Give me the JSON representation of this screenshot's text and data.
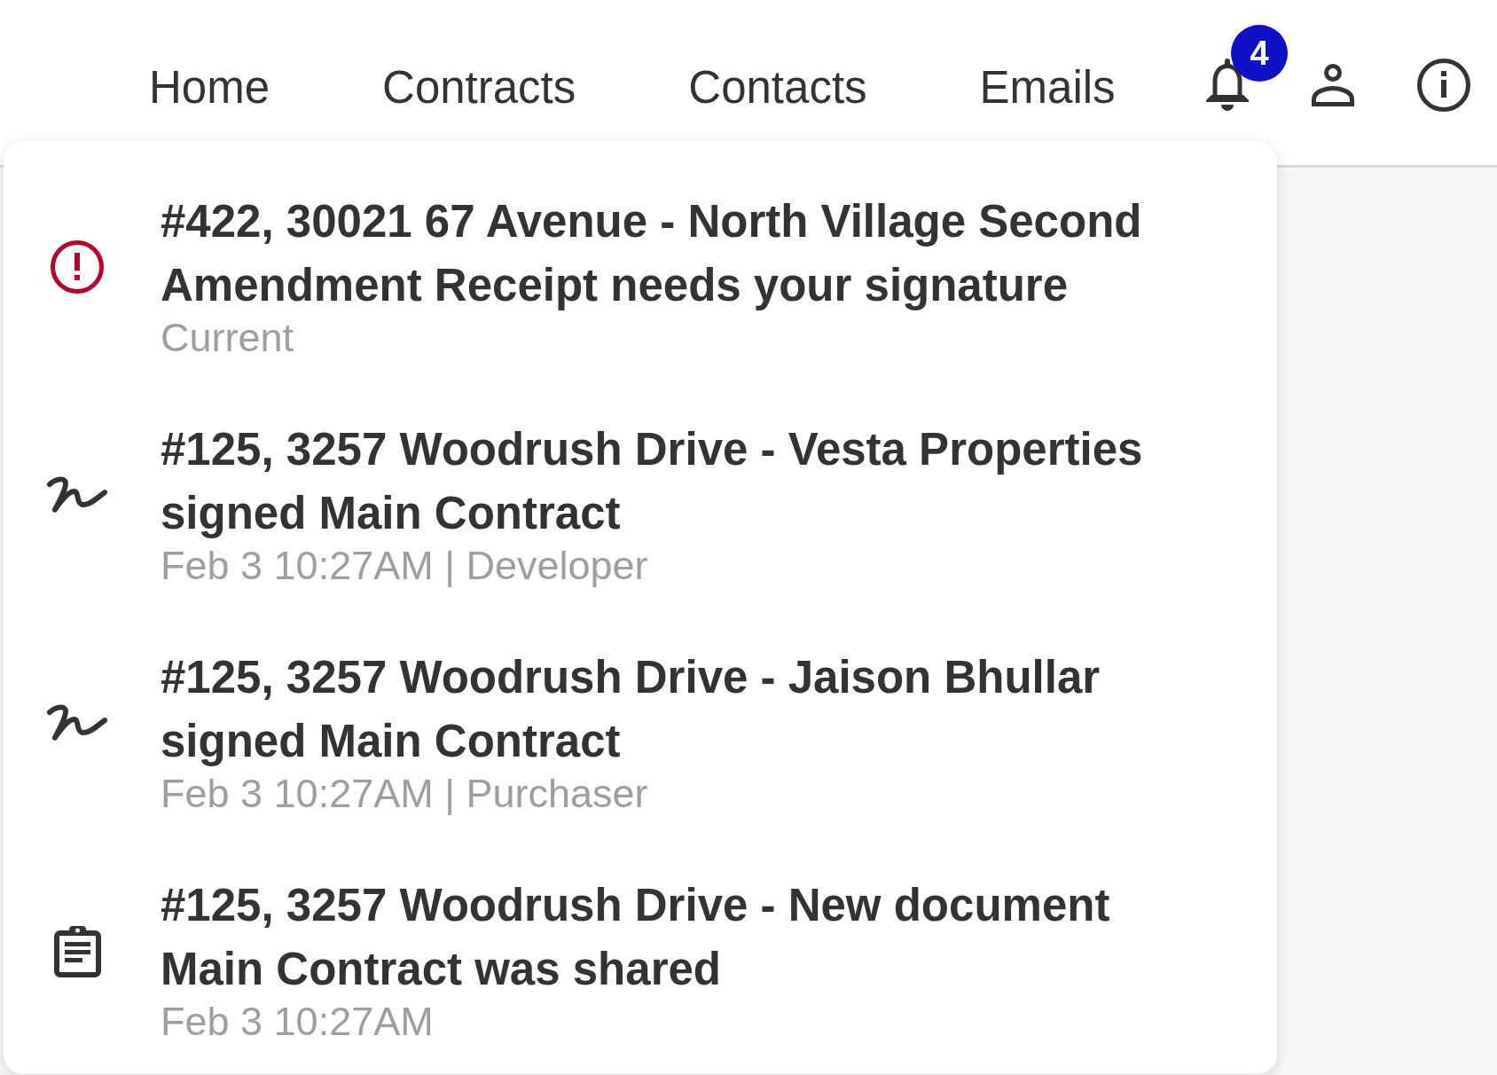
{
  "nav_links": [
    "Home",
    "Contracts",
    "Contacts",
    "Emails"
  ],
  "notification_count": "4",
  "notifications": [
    {
      "kind": "alert",
      "title": "#422, 30021 67 Avenue - North Village Second Amendment Receipt needs your signature",
      "meta": "Current"
    },
    {
      "kind": "signature",
      "title": "#125, 3257 Woodrush Drive - Vesta Properties signed Main Contract",
      "meta": "Feb 3 10:27AM | Developer"
    },
    {
      "kind": "signature",
      "title": "#125, 3257 Woodrush Drive - Jaison Bhullar signed Main Contract",
      "meta": "Feb 3 10:27AM | Purchaser"
    },
    {
      "kind": "document",
      "title": "#125, 3257 Woodrush Drive - New document Main Contract was shared",
      "meta": "Feb 3 10:27AM"
    }
  ]
}
